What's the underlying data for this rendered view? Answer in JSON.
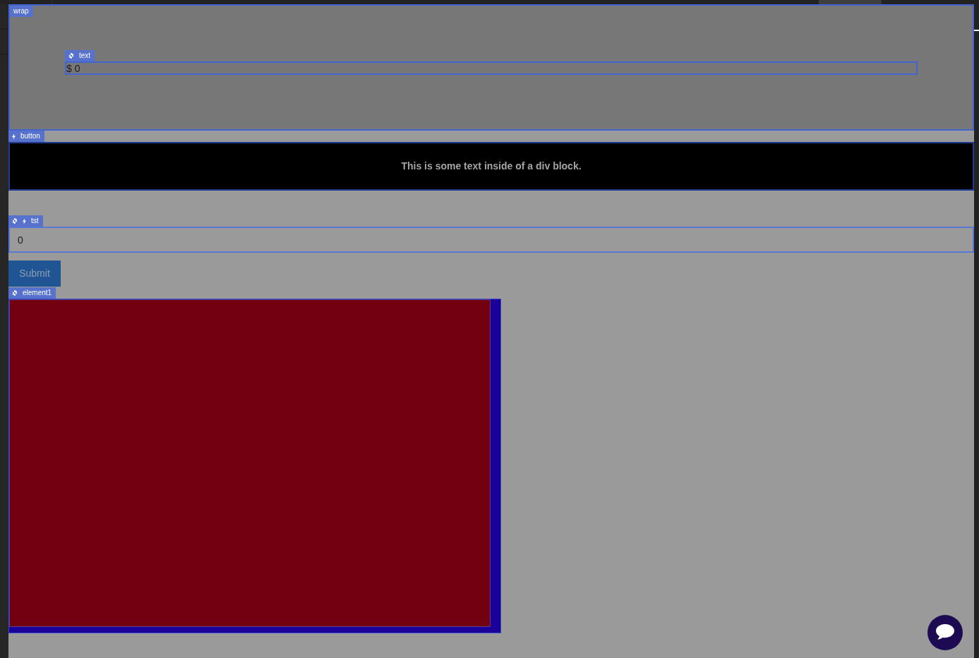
{
  "canvas": {
    "wrap": {
      "tag": "wrap",
      "text_element": {
        "tag": "text",
        "text": "$ 0"
      }
    },
    "button_block": {
      "tag": "button",
      "text": "This is some text inside of a div block."
    },
    "input": {
      "tag": "tst",
      "value": "0"
    },
    "submit_button": {
      "label": "Submit"
    },
    "element1": {
      "tag": "element1"
    }
  }
}
